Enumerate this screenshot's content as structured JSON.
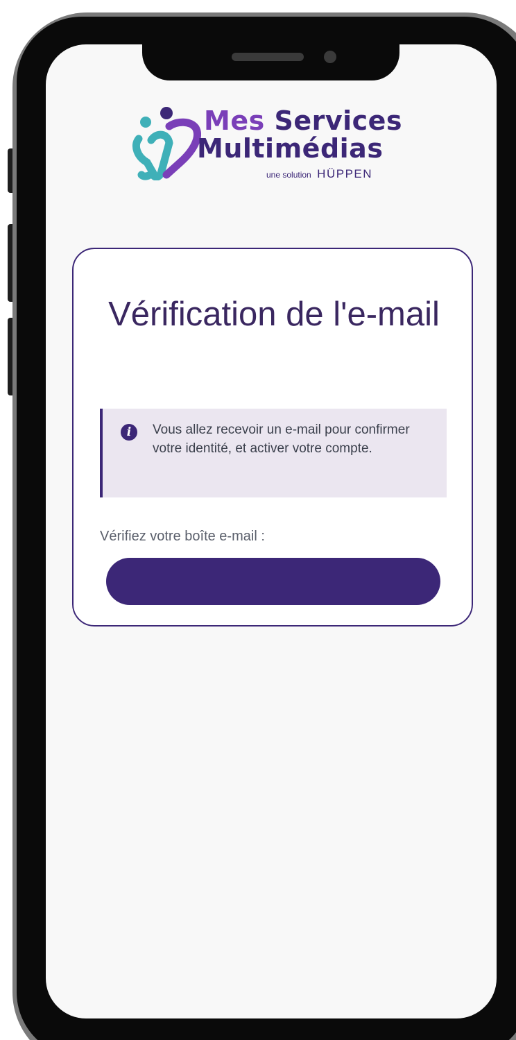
{
  "logo": {
    "name_part1": "Mes",
    "name_part2": "Services",
    "name_line2": "Multimédias",
    "tagline": "une solution",
    "tagline_brand": "HÜPPEN"
  },
  "card": {
    "title": "Vérification de l'e-mail",
    "info_icon": "info-icon",
    "info_message": "Vous allez recevoir un e-mail pour confirmer votre identité, et activer votre compte.",
    "check_label": "Vérifiez votre boîte e-mail :",
    "button_label": ""
  },
  "colors": {
    "primary": "#3c2777",
    "accent_purple": "#7a3fb8",
    "accent_teal": "#3fb0b8",
    "alert_bg": "#ebe6f0",
    "screen_bg": "#f8f8f8"
  }
}
